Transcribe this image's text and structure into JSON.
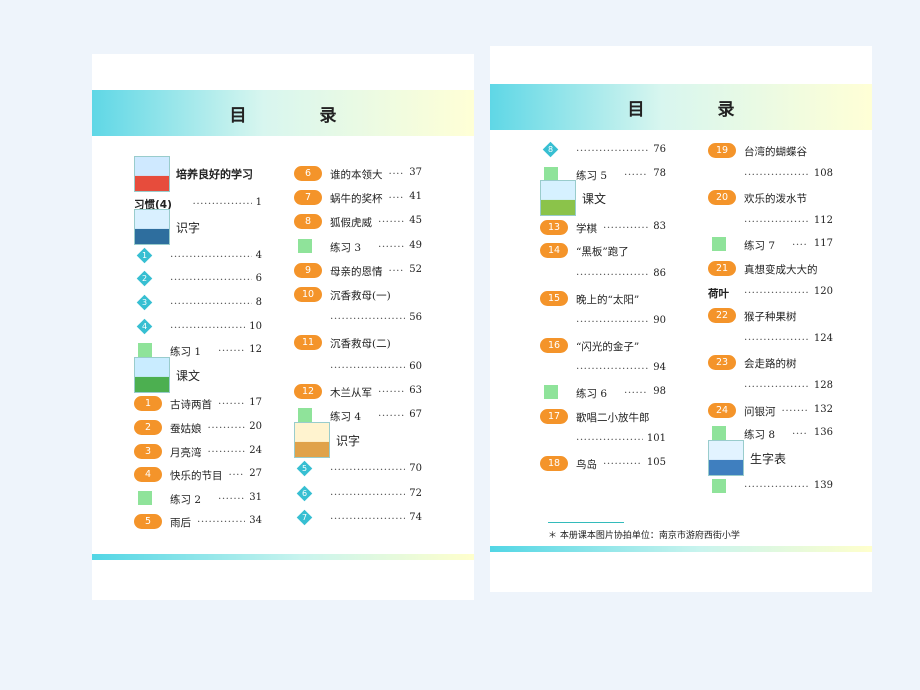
{
  "left_page": {
    "title": "目　录",
    "col1": [
      {
        "kind": "section",
        "label": "培养良好的学习",
        "icon": "kids-icon"
      },
      {
        "kind": "text",
        "label": "习惯(4)",
        "page": "1"
      },
      {
        "kind": "section",
        "label": "识字",
        "icon": "girl-icon"
      },
      {
        "kind": "diamond",
        "num": "1",
        "label": "",
        "page": "4"
      },
      {
        "kind": "diamond",
        "num": "2",
        "label": "",
        "page": "6"
      },
      {
        "kind": "diamond",
        "num": "3",
        "label": "",
        "page": "8"
      },
      {
        "kind": "diamond",
        "num": "4",
        "label": "",
        "page": "10"
      },
      {
        "kind": "square",
        "label": "练习 1",
        "page": "12"
      },
      {
        "kind": "section",
        "label": "课文",
        "icon": "landscape-icon"
      },
      {
        "kind": "pill",
        "num": "1",
        "label": "古诗两首",
        "page": "17"
      },
      {
        "kind": "pill",
        "num": "2",
        "label": "蚕姑娘",
        "page": "20"
      },
      {
        "kind": "pill",
        "num": "3",
        "label": "月亮湾",
        "page": "24"
      },
      {
        "kind": "pill",
        "num": "4",
        "label": "快乐的节目",
        "page": "27"
      },
      {
        "kind": "square",
        "label": "练习 2",
        "page": "31"
      },
      {
        "kind": "pill",
        "num": "5",
        "label": "雨后",
        "page": "34"
      }
    ],
    "col2": [
      {
        "kind": "pill",
        "num": "6",
        "label": "谁的本领大",
        "page": "37"
      },
      {
        "kind": "pill",
        "num": "7",
        "label": "蜗牛的奖杯",
        "page": "41"
      },
      {
        "kind": "pill",
        "num": "8",
        "label": "狐假虎威",
        "page": "45"
      },
      {
        "kind": "square",
        "label": "练习 3",
        "page": "49"
      },
      {
        "kind": "pill",
        "num": "9",
        "label": "母亲的恩情",
        "page": "52"
      },
      {
        "kind": "pill",
        "num": "10",
        "label": "沉香救母(一)",
        "page": ""
      },
      {
        "kind": "cont",
        "label": "",
        "page": "56"
      },
      {
        "kind": "pill",
        "num": "11",
        "label": "沉香救母(二)",
        "page": ""
      },
      {
        "kind": "cont",
        "label": "",
        "page": "60"
      },
      {
        "kind": "pill",
        "num": "12",
        "label": "木兰从军",
        "page": "63"
      },
      {
        "kind": "square",
        "label": "练习 4",
        "page": "67"
      },
      {
        "kind": "section",
        "label": "识字",
        "icon": "scroll-icon"
      },
      {
        "kind": "diamond",
        "num": "5",
        "label": "",
        "page": "70"
      },
      {
        "kind": "diamond",
        "num": "6",
        "label": "",
        "page": "72"
      },
      {
        "kind": "diamond",
        "num": "7",
        "label": "",
        "page": "74"
      }
    ]
  },
  "right_page": {
    "title": "目　录",
    "col1": [
      {
        "kind": "diamond",
        "num": "8",
        "label": "",
        "page": "76"
      },
      {
        "kind": "square",
        "label": "练习 5",
        "page": "78"
      },
      {
        "kind": "section",
        "label": "课文",
        "icon": "field-icon"
      },
      {
        "kind": "pill",
        "num": "13",
        "label": "学棋",
        "page": "83"
      },
      {
        "kind": "pill",
        "num": "14",
        "label": "“黑板”跑了",
        "page": ""
      },
      {
        "kind": "cont",
        "label": "",
        "page": "86"
      },
      {
        "kind": "pill",
        "num": "15",
        "label": "晚上的“太阳”",
        "page": ""
      },
      {
        "kind": "cont",
        "label": "",
        "page": "90"
      },
      {
        "kind": "pill",
        "num": "16",
        "label": "“闪光的金子”",
        "page": ""
      },
      {
        "kind": "cont",
        "label": "",
        "page": "94"
      },
      {
        "kind": "square",
        "label": "练习 6",
        "page": "98"
      },
      {
        "kind": "pill",
        "num": "17",
        "label": "歌唱二小放牛郎",
        "page": ""
      },
      {
        "kind": "cont",
        "label": "",
        "page": "101"
      },
      {
        "kind": "pill",
        "num": "18",
        "label": "鸟岛",
        "page": "105"
      }
    ],
    "col2": [
      {
        "kind": "pill",
        "num": "19",
        "label": "台湾的蝴蝶谷",
        "page": ""
      },
      {
        "kind": "cont",
        "label": "",
        "page": "108"
      },
      {
        "kind": "pill",
        "num": "20",
        "label": "欢乐的泼水节",
        "page": ""
      },
      {
        "kind": "cont",
        "label": "",
        "page": "112"
      },
      {
        "kind": "square",
        "label": "练习 7",
        "page": "117"
      },
      {
        "kind": "pill",
        "num": "21",
        "label": "真想变成大大的",
        "page": ""
      },
      {
        "kind": "text",
        "label": "荷叶",
        "page": "120"
      },
      {
        "kind": "pill",
        "num": "22",
        "label": "猴子种果树",
        "page": ""
      },
      {
        "kind": "cont",
        "label": "",
        "page": "124"
      },
      {
        "kind": "pill",
        "num": "23",
        "label": "会走路的树",
        "page": ""
      },
      {
        "kind": "cont",
        "label": "",
        "page": "128"
      },
      {
        "kind": "pill",
        "num": "24",
        "label": "问银河",
        "page": "132"
      },
      {
        "kind": "square",
        "label": "练习 8",
        "page": "136"
      },
      {
        "kind": "section",
        "label": "生字表",
        "icon": "boy-icon"
      },
      {
        "kind": "square",
        "label": "",
        "page": "139"
      }
    ],
    "footnote": "＊ 本册课本图片协拍单位：南京市游府西街小学"
  },
  "colors": {
    "pill": "#f4942a",
    "diamond": "#37bfd2",
    "square": "#8fe39a",
    "band_start": "#5fd7e6"
  }
}
